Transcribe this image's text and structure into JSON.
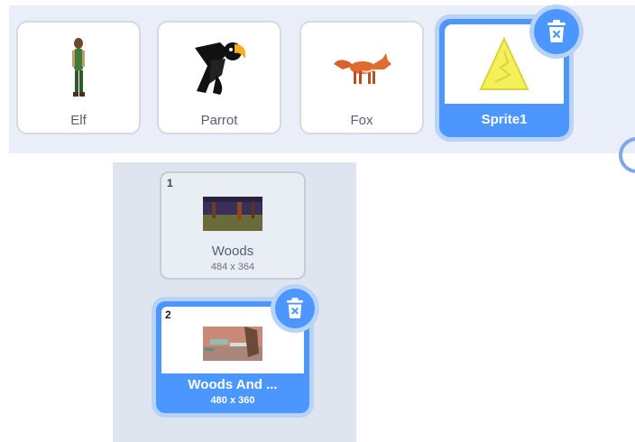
{
  "sprites": [
    {
      "name": "Elf",
      "icon": "elf-sprite-icon"
    },
    {
      "name": "Parrot",
      "icon": "parrot-sprite-icon"
    },
    {
      "name": "Fox",
      "icon": "fox-sprite-icon"
    },
    {
      "name": "Sprite1",
      "icon": "triangle-sprite-icon",
      "selected": true
    }
  ],
  "backdrops": [
    {
      "number": "1",
      "name": "Woods",
      "size": "484 x 364"
    },
    {
      "number": "2",
      "name": "Woods And ...",
      "size": "480 x 360",
      "selected": true
    }
  ],
  "icons": {
    "delete": "trash-icon"
  },
  "colors": {
    "accent": "#4c97ff",
    "halo": "#b9d3f8",
    "pane": "#e9eef8",
    "backdrop_pane": "#dfe5ef",
    "text": "#575e75"
  }
}
